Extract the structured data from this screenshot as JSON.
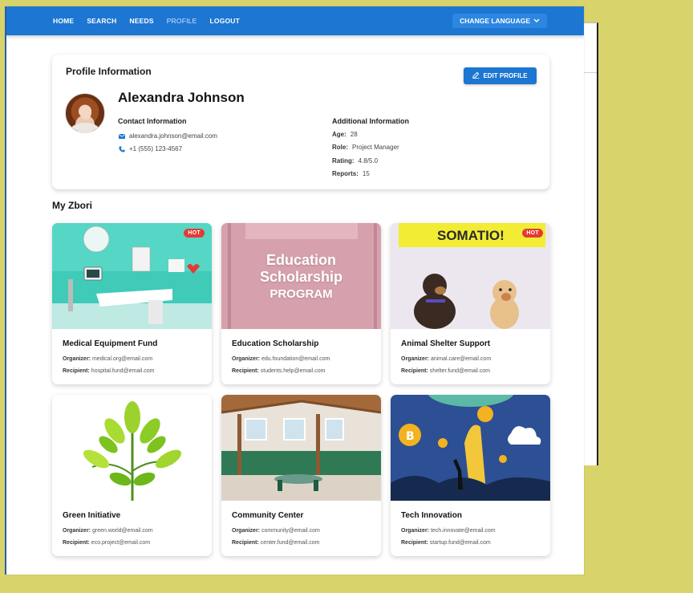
{
  "nav": {
    "items": [
      {
        "label": "HOME"
      },
      {
        "label": "SEARCH"
      },
      {
        "label": "NEEDS"
      },
      {
        "label": "PROFILE",
        "active": true
      },
      {
        "label": "LOGOUT"
      }
    ],
    "language_label": "CHANGE LANGUAGE"
  },
  "profile": {
    "title": "Profile Information",
    "edit_label": "EDIT PROFILE",
    "name": "Alexandra Johnson",
    "contact_heading": "Contact Information",
    "email": "alexandra.johnson@email.com",
    "phone": "+1 (555) 123-4567",
    "additional_heading": "Additional Information",
    "age_label": "Age:",
    "age": "28",
    "role_label": "Role:",
    "role": "Project Manager",
    "rating_label": "Rating:",
    "rating": "4.8/5.0",
    "reports_label": "Reports:",
    "reports": "15"
  },
  "section_title": "My Zbori",
  "labels": {
    "organizer": "Organizer:",
    "recipient": "Recipient:",
    "hot": "HOT"
  },
  "cards": [
    {
      "title": "Medical Equipment Fund",
      "organizer": "medical.org@email.com",
      "recipient": "hospital.fund@email.com",
      "hot": true
    },
    {
      "title": "Education Scholarship",
      "organizer": "edu.foundation@email.com",
      "recipient": "students.help@email.com",
      "hot": false,
      "image_text": [
        "Education",
        "Scholarship",
        "PROGRAM"
      ]
    },
    {
      "title": "Animal Shelter Support",
      "organizer": "animal.care@email.com",
      "recipient": "shelter.fund@email.com",
      "hot": true,
      "image_text": "SOMATIO!"
    },
    {
      "title": "Green Initiative",
      "organizer": "green.world@email.com",
      "recipient": "eco.project@email.com",
      "hot": false
    },
    {
      "title": "Community Center",
      "organizer": "community@email.com",
      "recipient": "center.fund@email.com",
      "hot": false
    },
    {
      "title": "Tech Innovation",
      "organizer": "tech.innovate@email.com",
      "recipient": "startup.fund@email.com",
      "hot": false
    }
  ],
  "colors": {
    "primary": "#1d76d2",
    "hot": "#e53935",
    "backdrop": "#d8d36a"
  }
}
